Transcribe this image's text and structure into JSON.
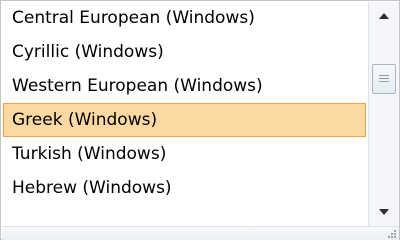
{
  "encoding_list": {
    "items": [
      {
        "label": "Central European (Windows)",
        "selected": false
      },
      {
        "label": "Cyrillic (Windows)",
        "selected": false
      },
      {
        "label": "Western European (Windows)",
        "selected": false
      },
      {
        "label": "Greek (Windows)",
        "selected": true
      },
      {
        "label": "Turkish (Windows)",
        "selected": false
      },
      {
        "label": "Hebrew (Windows)",
        "selected": false
      }
    ]
  },
  "scrollbar": {
    "up_icon": "scroll-up-arrow-icon",
    "down_icon": "scroll-down-arrow-icon"
  },
  "colors": {
    "selected_background": "#fcd9a3",
    "selected_border": "#f0a247",
    "border": "#c5c5c5"
  }
}
